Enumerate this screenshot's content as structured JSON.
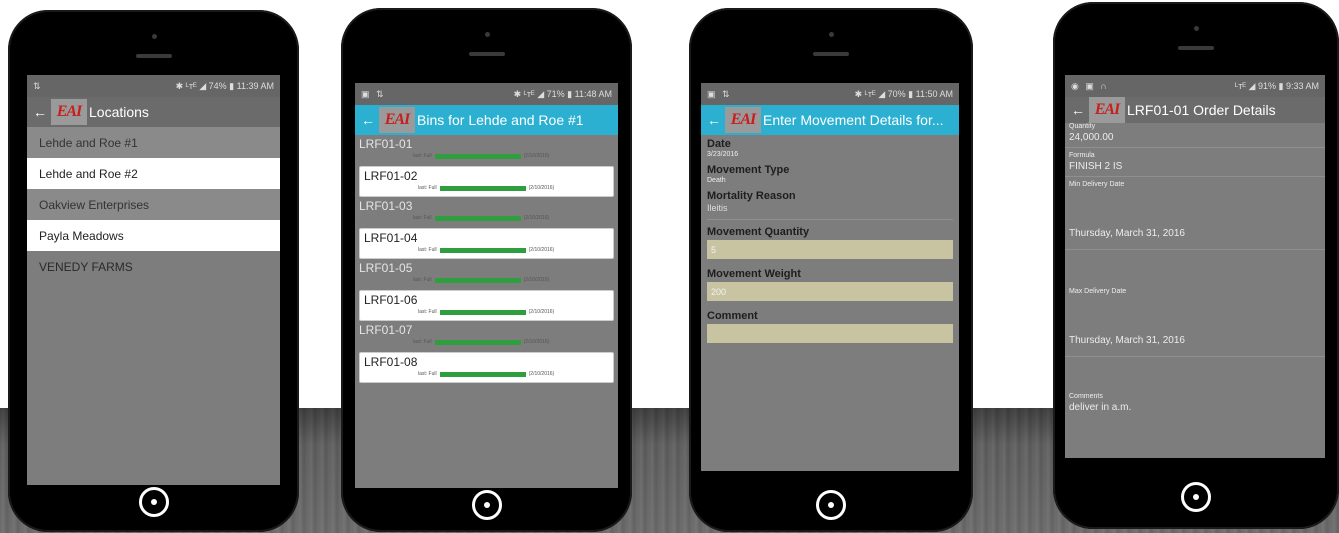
{
  "phone1": {
    "status": {
      "time": "11:39 AM",
      "battery": "74%",
      "left_icons": "⇅",
      "signal": "✱ ᴸᴛᴱ ◢"
    },
    "appbar": {
      "title": "Locations",
      "logo": "EAI",
      "color": "#6b6b6b"
    },
    "locations": [
      {
        "label": "Lehde and Roe #1",
        "style": "gray"
      },
      {
        "label": "Lehde and Roe #2",
        "style": "white"
      },
      {
        "label": "Oakview Enterprises",
        "style": "gray"
      },
      {
        "label": "Payla Meadows",
        "style": "white"
      },
      {
        "label": "VENEDY FARMS",
        "style": "none"
      }
    ]
  },
  "phone2": {
    "status": {
      "time": "11:48 AM",
      "battery": "71%",
      "left_icons": "▣ ⇅",
      "signal": "✱ ᴸᴛᴱ ◢"
    },
    "appbar": {
      "title": "Bins for Lehde and Roe #1",
      "logo": "EAI",
      "color": "#2bb0d1"
    },
    "bins": [
      {
        "code": "LRF01-01",
        "status": "last: Full",
        "date": "(2/10/2016)",
        "style": "gray"
      },
      {
        "code": "LRF01-02",
        "status": "last: Full",
        "date": "(2/10/2016)",
        "style": "white"
      },
      {
        "code": "LRF01-03",
        "status": "last: Full",
        "date": "(2/10/2016)",
        "style": "gray"
      },
      {
        "code": "LRF01-04",
        "status": "last: Full",
        "date": "(2/10/2016)",
        "style": "white"
      },
      {
        "code": "LRF01-05",
        "status": "last: Full",
        "date": "(2/10/2016)",
        "style": "gray"
      },
      {
        "code": "LRF01-06",
        "status": "last: Full",
        "date": "(2/10/2016)",
        "style": "white"
      },
      {
        "code": "LRF01-07",
        "status": "last: Full",
        "date": "(2/10/2016)",
        "style": "gray"
      },
      {
        "code": "LRF01-08",
        "status": "last: Full",
        "date": "(2/10/2016)",
        "style": "white"
      }
    ]
  },
  "phone3": {
    "status": {
      "time": "11:50 AM",
      "battery": "70%",
      "left_icons": "▣ ⇅",
      "signal": "✱ ᴸᴛᴱ ◢"
    },
    "appbar": {
      "title": "Enter Movement Details for...",
      "logo": "EAI",
      "color": "#2bb0d1"
    },
    "fields": {
      "date_label": "Date",
      "date_value": "3/23/2016",
      "movement_type_label": "Movement Type",
      "movement_type_value": "Death",
      "mortality_reason_label": "Mortality Reason",
      "mortality_reason_value": "Ileitis",
      "movement_quantity_label": "Movement Quantity",
      "movement_quantity_value": "5",
      "movement_weight_label": "Movement Weight",
      "movement_weight_value": "200",
      "comment_label": "Comment",
      "comment_value": ""
    }
  },
  "phone4": {
    "status": {
      "time": "9:33 AM",
      "battery": "91%",
      "left_icons": "◉ ▣ ∩",
      "signal": "ᴸᴛᴱ ◢"
    },
    "appbar": {
      "title": "LRF01-01 Order Details",
      "logo": "EAI",
      "color": "#6b6b6b"
    },
    "details": {
      "quantity_label": "Quantity",
      "quantity_value": "24,000.00",
      "formula_label": "Formula",
      "formula_value": "FINISH 2 IS",
      "min_delivery_label": "Min Delivery Date",
      "min_delivery_value": "Thursday, March 31, 2016",
      "max_delivery_label": "Max Delivery Date",
      "max_delivery_value": "Thursday, March 31, 2016",
      "comments_label": "Comments",
      "comments_value": "deliver in a.m."
    }
  }
}
